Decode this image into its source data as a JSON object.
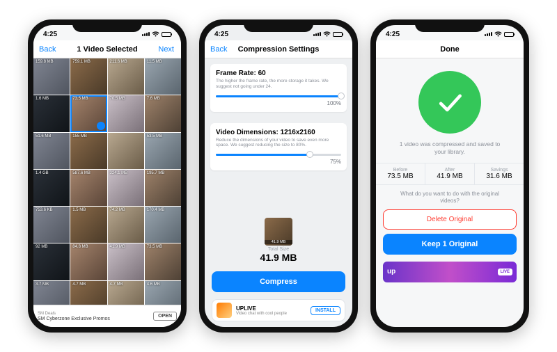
{
  "status_time": "4:25",
  "screen1": {
    "back": "Back",
    "title": "1 Video Selected",
    "next": "Next",
    "thumbs": [
      {
        "size": "159.8 MB"
      },
      {
        "size": "759.1 MB"
      },
      {
        "size": "211.6 MB"
      },
      {
        "size": "11.5 MB"
      },
      {
        "size": "1.6 MB"
      },
      {
        "size": "73.5 MB",
        "selected": true
      },
      {
        "size": "70.5 MB"
      },
      {
        "size": "7.6 MB"
      },
      {
        "size": "51.6 MB"
      },
      {
        "size": "155 MB"
      },
      {
        "size": ""
      },
      {
        "size": "53.5 MB"
      },
      {
        "size": "1.4 GB"
      },
      {
        "size": "587.6 MB"
      },
      {
        "size": "324.1 MB"
      },
      {
        "size": "195.7 MB"
      },
      {
        "size": "753.6 KB"
      },
      {
        "size": "1.5 MB"
      },
      {
        "size": "74.2 MB"
      },
      {
        "size": "170.4 MB"
      },
      {
        "size": "92 MB"
      },
      {
        "size": "84.8 MB"
      },
      {
        "size": "41.9 MB"
      },
      {
        "size": "73.5 MB"
      },
      {
        "size": "3.7 MB"
      },
      {
        "size": "4.7 MB"
      },
      {
        "size": "4.7 MB"
      },
      {
        "size": "4.6 MB"
      }
    ],
    "ad": {
      "tag": "SM Deals",
      "line": "SM Cyberzone Exclusive Promos",
      "cta": "OPEN"
    }
  },
  "screen2": {
    "back": "Back",
    "title": "Compression Settings",
    "frame": {
      "title": "Frame Rate: 60",
      "desc": "The higher the frame rate, the more storage it takes. We suggest not going under 24.",
      "pct": "100%",
      "fill": 100
    },
    "dim": {
      "title": "Video Dimensions: 1216x2160",
      "desc": "Reduce the dimensions of your video to save even more space. We suggest reducing the size to 80%.",
      "pct": "75%",
      "fill": 75
    },
    "thumb_size": "41.9 MB",
    "total_label": "Total Size",
    "total_value": "41.9 MB",
    "compress": "Compress",
    "ad": {
      "name": "UPLIVE",
      "tag": "Video chat with cool people",
      "cta": "INSTALL"
    }
  },
  "screen3": {
    "title": "Done",
    "msg": "1 video was compressed and saved to your library.",
    "stats": {
      "before_lbl": "Before",
      "before": "73.5 MB",
      "after_lbl": "After",
      "after": "41.9 MB",
      "sav_lbl": "Savings",
      "sav": "31.6 MB"
    },
    "question": "What do you want to do with the original videos?",
    "delete": "Delete Original",
    "keep": "Keep 1 Original",
    "banner_brand": "up",
    "banner_live": "LIVE"
  }
}
